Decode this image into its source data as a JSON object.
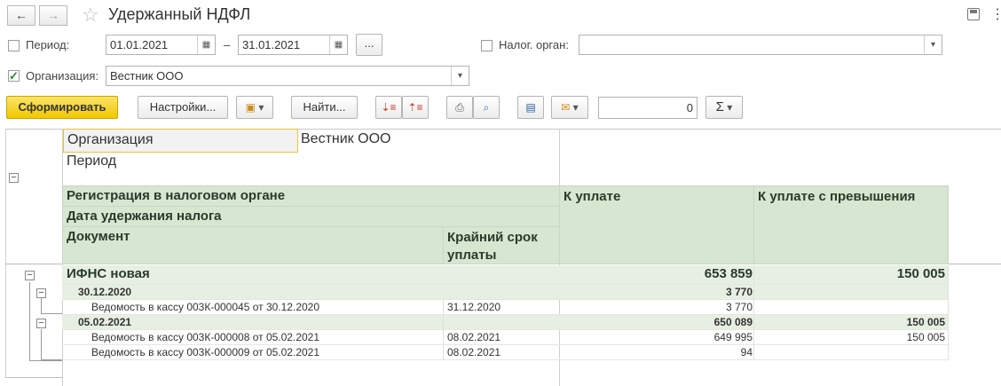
{
  "window": {
    "title": "Удержанный НДФЛ",
    "back_icon": "←",
    "forward_icon": "→"
  },
  "filters": {
    "period_label": "Период:",
    "period_checked": false,
    "date_from": "01.01.2021",
    "dash": "–",
    "date_to": "31.01.2021",
    "more_btn": "...",
    "tax_office_label": "Налог. орган:",
    "tax_office_checked": false,
    "tax_office_value": "",
    "org_label": "Организация:",
    "org_checked": true,
    "org_value": "Вестник ООО"
  },
  "toolbar": {
    "generate": "Сформировать",
    "settings": "Настройки...",
    "find": "Найти...",
    "counter": "0",
    "sigma": "Σ"
  },
  "report": {
    "org_label": "Организация",
    "org_value": "Вестник ООО",
    "period_label": "Период",
    "headers": {
      "registration": "Регистрация в налоговом органе",
      "date": "Дата удержания налога",
      "document": "Документ",
      "deadline": "Крайний срок уплаты",
      "to_pay": "К уплате",
      "to_pay_excess": "К уплате с превышения"
    },
    "total": {
      "name": "ИФНС новая",
      "to_pay": "653 859",
      "excess": "150 005"
    },
    "groups": [
      {
        "date": "30.12.2020",
        "to_pay": "3 770",
        "excess": "",
        "rows": [
          {
            "doc": "Ведомость в кассу 003К-000045 от 30.12.2020",
            "deadline": "31.12.2020",
            "to_pay": "3 770",
            "excess": ""
          }
        ]
      },
      {
        "date": "05.02.2021",
        "to_pay": "650 089",
        "excess": "150 005",
        "rows": [
          {
            "doc": "Ведомость в кассу 003К-000008 от 05.02.2021",
            "deadline": "08.02.2021",
            "to_pay": "649 995",
            "excess": "150 005"
          },
          {
            "doc": "Ведомость в кассу 003К-000009 от 05.02.2021",
            "deadline": "08.02.2021",
            "to_pay": "94",
            "excess": ""
          }
        ]
      }
    ]
  }
}
